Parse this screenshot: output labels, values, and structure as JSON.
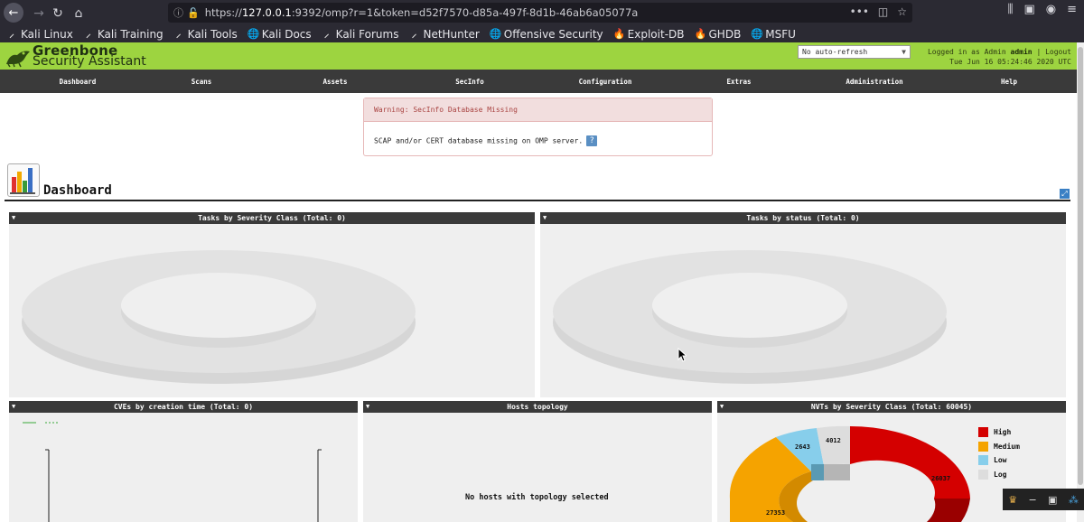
{
  "browser": {
    "url_prefix": "https://",
    "url_host": "127.0.0.1",
    "url_rest": ":9392/omp?r=1&token=d52f7570-d85a-497f-8d1b-46ab6a05077a",
    "url_menu": "•••",
    "bookmarks": [
      {
        "label": "Kali Linux",
        "icon": "kali-dragon-icon"
      },
      {
        "label": "Kali Training",
        "icon": "kali-dragon-icon"
      },
      {
        "label": "Kali Tools",
        "icon": "kali-dragon-icon"
      },
      {
        "label": "Kali Docs",
        "icon": "globe-icon"
      },
      {
        "label": "Kali Forums",
        "icon": "kali-dragon-icon"
      },
      {
        "label": "NetHunter",
        "icon": "kali-dragon-icon"
      },
      {
        "label": "Offensive Security",
        "icon": "globe-icon"
      },
      {
        "label": "Exploit-DB",
        "icon": "exploitdb-icon"
      },
      {
        "label": "GHDB",
        "icon": "exploitdb-icon"
      },
      {
        "label": "MSFU",
        "icon": "globe-icon"
      }
    ]
  },
  "header": {
    "brand_line1": "Greenbone",
    "brand_line2": "Security Assistant",
    "refresh_value": "No auto-refresh",
    "logged_in_label": "Logged in as",
    "role": "Admin",
    "username": "admin",
    "separator": "|",
    "logout": "Logout",
    "datetime": "Tue Jun 16 05:24:46 2020 UTC"
  },
  "menu": [
    "Dashboard",
    "Scans",
    "Assets",
    "SecInfo",
    "Configuration",
    "Extras",
    "Administration",
    "Help"
  ],
  "warning": {
    "title": "Warning: SecInfo Database Missing",
    "body": "SCAP and/or CERT database missing on OMP server.",
    "help": "?"
  },
  "page": {
    "title": "Dashboard"
  },
  "panels": {
    "tasks_severity": "Tasks by Severity Class (Total: 0)",
    "tasks_status": "Tasks by status (Total: 0)",
    "cves_time": "CVEs by creation time (Total: 0)",
    "hosts_topology": "Hosts topology",
    "nvts_severity": "NVTs by Severity Class (Total: 60045)",
    "no_hosts": "No hosts with topology selected"
  },
  "nvts": {
    "legend": [
      {
        "label": "High",
        "color": "#d40000"
      },
      {
        "label": "Medium",
        "color": "#f5a300"
      },
      {
        "label": "Low",
        "color": "#87ceeb"
      },
      {
        "label": "Log",
        "color": "#dddddd"
      }
    ],
    "labels": {
      "high": "26037",
      "medium": "27353",
      "low": "2643",
      "log": "4012"
    }
  },
  "colors": {
    "header_green": "#9dd440",
    "menu_dark": "#3a3a3a"
  }
}
